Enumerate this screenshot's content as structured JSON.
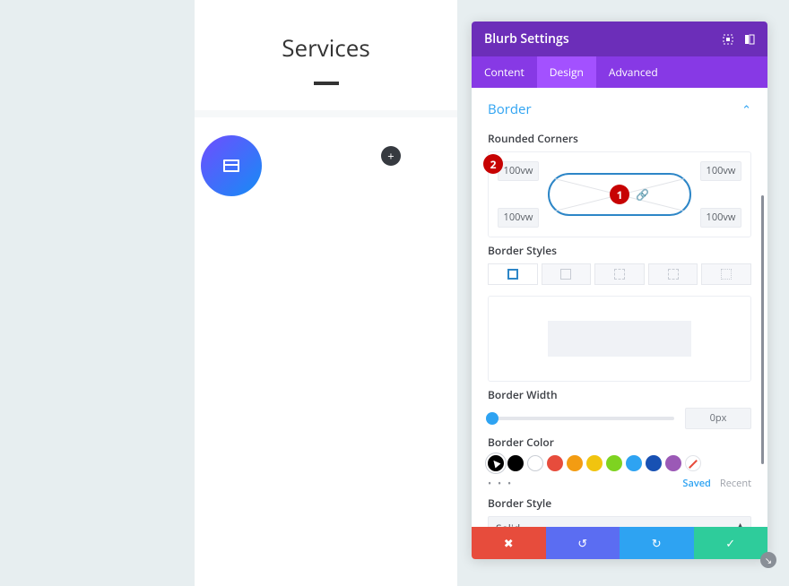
{
  "canvas": {
    "title": "Services",
    "add_icon": "+"
  },
  "panel": {
    "title": "Blurb Settings",
    "tabs": {
      "content": "Content",
      "design": "Design",
      "advanced": "Advanced"
    }
  },
  "section": {
    "title": "Border"
  },
  "rounded": {
    "label": "Rounded Corners",
    "tl": "100vw",
    "tr": "100vw",
    "bl": "100vw",
    "br": "100vw",
    "badge_center": "1",
    "badge_left": "2"
  },
  "borderStyles": {
    "label": "Border Styles"
  },
  "borderWidth": {
    "label": "Border Width",
    "value": "0px"
  },
  "borderColor": {
    "label": "Border Color",
    "swatches": [
      "#000000",
      "#ffffff",
      "#e74c3c",
      "#f39c12",
      "#f1c40f",
      "#7ed321",
      "#2ea3f2",
      "#1851b3",
      "#9b59b6"
    ],
    "more": "• • •",
    "saved": "Saved",
    "recent": "Recent"
  },
  "borderStyle": {
    "label": "Border Style",
    "value": "Solid"
  },
  "footer": {
    "del": "✖",
    "undo": "↺",
    "redo": "↻",
    "ok": "✓"
  }
}
